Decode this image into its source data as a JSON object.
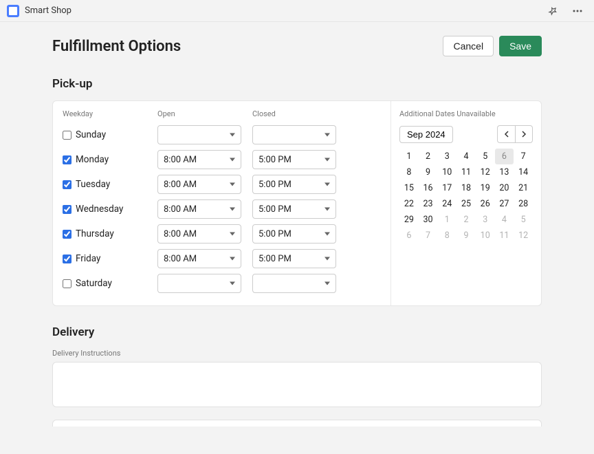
{
  "app": {
    "name": "Smart Shop"
  },
  "header": {
    "title": "Fulfillment Options",
    "cancel_label": "Cancel",
    "save_label": "Save"
  },
  "pickup": {
    "section_title": "Pick-up",
    "columns": {
      "weekday": "Weekday",
      "open": "Open",
      "closed": "Closed"
    },
    "rows": [
      {
        "label": "Sunday",
        "checked": false,
        "open": "",
        "closed": ""
      },
      {
        "label": "Monday",
        "checked": true,
        "open": "8:00 AM",
        "closed": "5:00 PM"
      },
      {
        "label": "Tuesday",
        "checked": true,
        "open": "8:00 AM",
        "closed": "5:00 PM"
      },
      {
        "label": "Wednesday",
        "checked": true,
        "open": "8:00 AM",
        "closed": "5:00 PM"
      },
      {
        "label": "Thursday",
        "checked": true,
        "open": "8:00 AM",
        "closed": "5:00 PM"
      },
      {
        "label": "Friday",
        "checked": true,
        "open": "8:00 AM",
        "closed": "5:00 PM"
      },
      {
        "label": "Saturday",
        "checked": false,
        "open": "",
        "closed": ""
      }
    ]
  },
  "calendar": {
    "header": "Additional Dates Unavailable",
    "month_label": "Sep 2024",
    "today": 6,
    "cells": [
      {
        "n": 1,
        "muted": false
      },
      {
        "n": 2,
        "muted": false
      },
      {
        "n": 3,
        "muted": false
      },
      {
        "n": 4,
        "muted": false
      },
      {
        "n": 5,
        "muted": false
      },
      {
        "n": 6,
        "muted": false
      },
      {
        "n": 7,
        "muted": false
      },
      {
        "n": 8,
        "muted": false
      },
      {
        "n": 9,
        "muted": false
      },
      {
        "n": 10,
        "muted": false
      },
      {
        "n": 11,
        "muted": false
      },
      {
        "n": 12,
        "muted": false
      },
      {
        "n": 13,
        "muted": false
      },
      {
        "n": 14,
        "muted": false
      },
      {
        "n": 15,
        "muted": false
      },
      {
        "n": 16,
        "muted": false
      },
      {
        "n": 17,
        "muted": false
      },
      {
        "n": 18,
        "muted": false
      },
      {
        "n": 19,
        "muted": false
      },
      {
        "n": 20,
        "muted": false
      },
      {
        "n": 21,
        "muted": false
      },
      {
        "n": 22,
        "muted": false
      },
      {
        "n": 23,
        "muted": false
      },
      {
        "n": 24,
        "muted": false
      },
      {
        "n": 25,
        "muted": false
      },
      {
        "n": 26,
        "muted": false
      },
      {
        "n": 27,
        "muted": false
      },
      {
        "n": 28,
        "muted": false
      },
      {
        "n": 29,
        "muted": false
      },
      {
        "n": 30,
        "muted": false
      },
      {
        "n": 1,
        "muted": true
      },
      {
        "n": 2,
        "muted": true
      },
      {
        "n": 3,
        "muted": true
      },
      {
        "n": 4,
        "muted": true
      },
      {
        "n": 5,
        "muted": true
      },
      {
        "n": 6,
        "muted": true
      },
      {
        "n": 7,
        "muted": true
      },
      {
        "n": 8,
        "muted": true
      },
      {
        "n": 9,
        "muted": true
      },
      {
        "n": 10,
        "muted": true
      },
      {
        "n": 11,
        "muted": true
      },
      {
        "n": 12,
        "muted": true
      }
    ]
  },
  "delivery": {
    "section_title": "Delivery",
    "instructions_label": "Delivery Instructions",
    "instructions_value": ""
  }
}
